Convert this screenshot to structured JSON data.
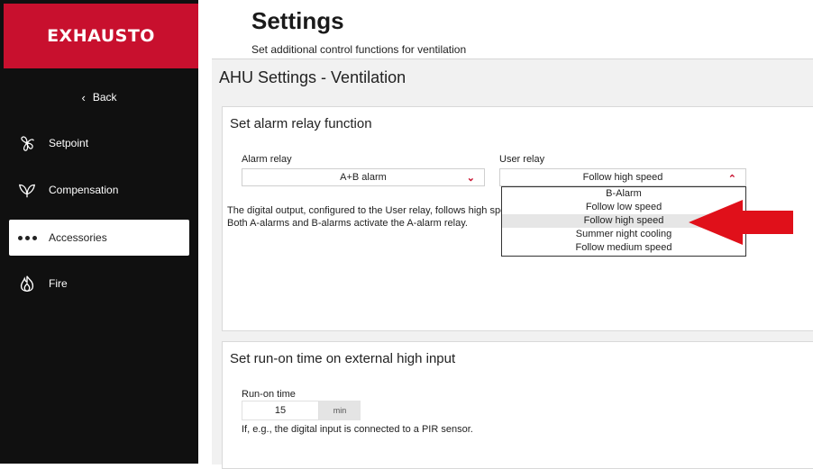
{
  "sidebar": {
    "logo": "EXHAUSTO",
    "back_label": "Back",
    "items": [
      {
        "label": "Setpoint",
        "icon": "fan-icon"
      },
      {
        "label": "Compensation",
        "icon": "leaf-icon"
      },
      {
        "label": "Accessories",
        "icon": "dots-icon",
        "active": true
      },
      {
        "label": "Fire",
        "icon": "flame-icon"
      }
    ]
  },
  "header": {
    "title": "Settings",
    "subtitle": "Set additional control functions for ventilation"
  },
  "section": {
    "title": "AHU Settings - Ventilation"
  },
  "alarm_panel": {
    "title": "Set alarm relay function",
    "alarm_relay": {
      "label": "Alarm relay",
      "value": "A+B alarm"
    },
    "user_relay": {
      "label": "User relay",
      "value": "Follow high speed",
      "options": [
        "B-Alarm",
        "Follow low speed",
        "Follow high speed",
        "Summer night cooling",
        "Follow medium speed"
      ],
      "highlighted": "Follow high speed"
    },
    "desc_line1": "The digital output, configured to the User relay, follows high spee",
    "desc_line2": "Both A-alarms and B-alarms activate the A-alarm relay."
  },
  "runon_panel": {
    "title": "Set run-on time on external high input",
    "label": "Run-on time",
    "value": "15",
    "unit": "min",
    "desc": "If, e.g., the digital input is connected to a PIR sensor."
  },
  "colors": {
    "accent": "#c8102e",
    "sidebar_bg": "#101010",
    "arrow": "#e0101a"
  }
}
